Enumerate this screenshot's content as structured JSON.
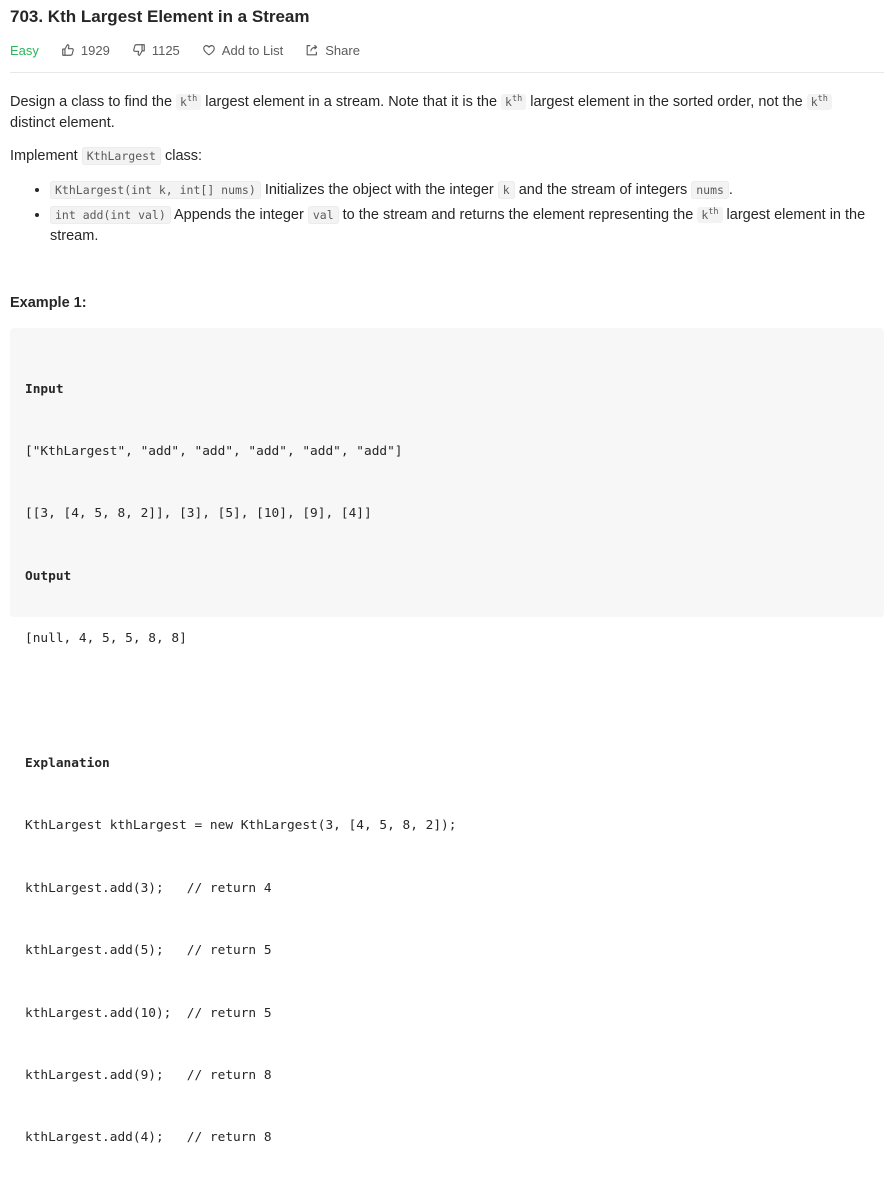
{
  "problem": {
    "title": "703. Kth Largest Element in a Stream",
    "difficulty": "Easy",
    "likes": "1929",
    "dislikes": "1125",
    "add_to_list": "Add to List",
    "share": "Share",
    "colors": {
      "easy": "#2db55d",
      "text": "#262626",
      "muted": "#5c5c5c"
    }
  },
  "description": {
    "p1_a": "Design a class to find the ",
    "p1_b": " largest element in a stream. Note that it is the ",
    "p1_c": " largest element in the sorted order, not the ",
    "p1_d": " distinct element.",
    "kth_base": "k",
    "kth_sup": "th",
    "p2_a": "Implement ",
    "p2_code": "KthLargest",
    "p2_b": " class:",
    "b1_code": "KthLargest(int k, int[] nums)",
    "b1_a": " Initializes the object with the integer ",
    "b1_k": "k",
    "b1_b": " and the stream of integers ",
    "b1_nums": "nums",
    "b1_c": ".",
    "b2_code": "int add(int val)",
    "b2_a": " Appends the integer ",
    "b2_val": "val",
    "b2_b": " to the stream and returns the element representing the ",
    "b2_c": " largest element in the stream."
  },
  "example": {
    "title": "Example 1:",
    "input_label": "Input",
    "input_line1": "[\"KthLargest\", \"add\", \"add\", \"add\", \"add\", \"add\"]",
    "input_line2": "[[3, [4, 5, 8, 2]], [3], [5], [10], [9], [4]]",
    "output_label": "Output",
    "output_line": "[null, 4, 5, 5, 8, 8]",
    "explanation_label": "Explanation",
    "explanation_lines": [
      "KthLargest kthLargest = new KthLargest(3, [4, 5, 8, 2]);",
      "kthLargest.add(3);   // return 4",
      "kthLargest.add(5);   // return 5",
      "kthLargest.add(10);  // return 5",
      "kthLargest.add(9);   // return 8",
      "kthLargest.add(4);   // return 8"
    ]
  }
}
